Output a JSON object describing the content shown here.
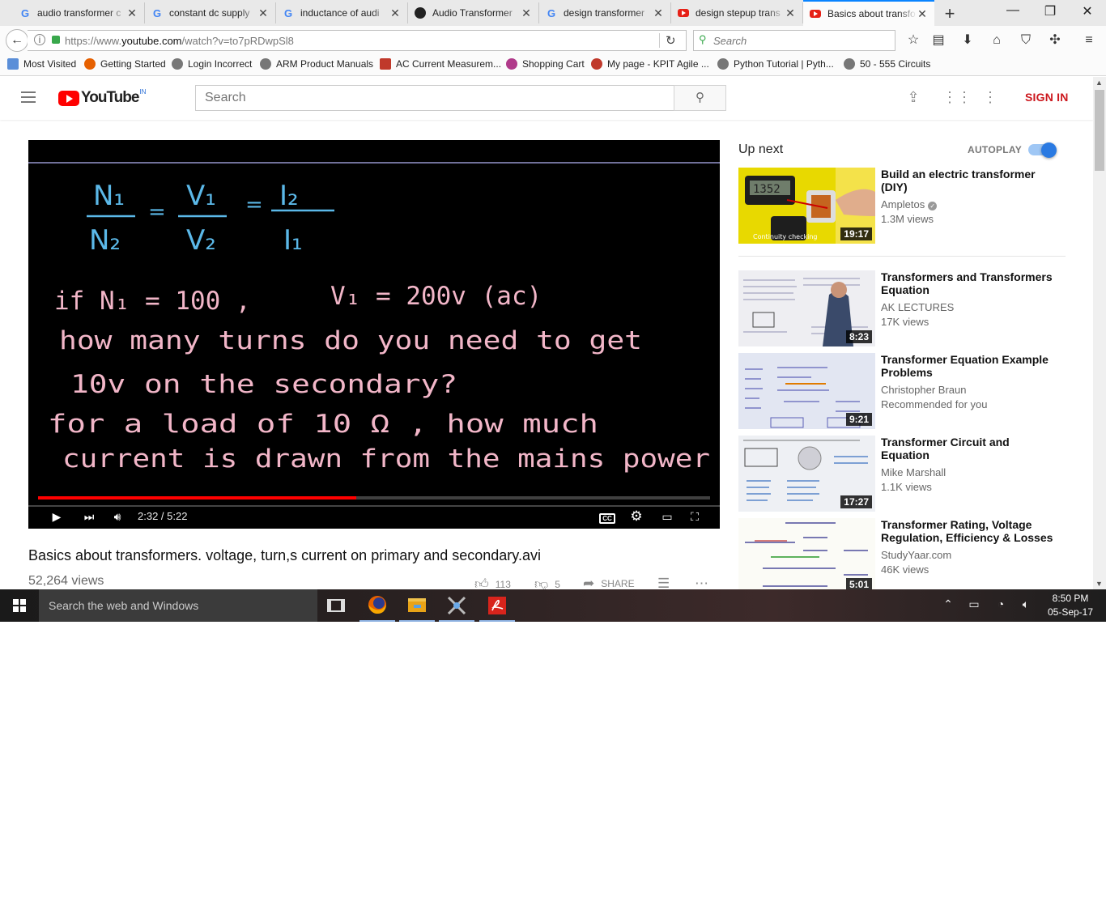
{
  "browser": {
    "tabs": [
      {
        "title": "audio transformer c",
        "icon": "google-icon"
      },
      {
        "title": "constant dc supply",
        "icon": "google-icon"
      },
      {
        "title": "inductance of audi",
        "icon": "google-icon"
      },
      {
        "title": "Audio Transformer",
        "icon": "site-icon"
      },
      {
        "title": "design transformer",
        "icon": "google-icon"
      },
      {
        "title": "design stepup trans",
        "icon": "youtube-icon"
      },
      {
        "title": "Basics about transfo",
        "icon": "youtube-icon"
      }
    ],
    "url_prefix": "https://www.",
    "url_host": "youtube.com",
    "url_path": "/watch?v=to7pRDwpSl8",
    "search_placeholder": "Search",
    "bookmarks": [
      "Most Visited",
      "Getting Started",
      "Login Incorrect",
      "ARM Product Manuals",
      "AC Current Measurem...",
      "Shopping Cart",
      "My page - KPIT Agile ...",
      "Python Tutorial | Pyth...",
      "50 - 555 Circuits"
    ]
  },
  "youtube": {
    "logo_text": "YouTube",
    "country_code": "IN",
    "search_placeholder": "Search",
    "sign_in": "SIGN IN"
  },
  "player": {
    "time_current": "2:32",
    "time_total": "5:22",
    "progress_fraction": 0.473,
    "cc_label": "CC",
    "board_lines": {
      "n1": "N₁",
      "n2": "N₂",
      "v1": "V₁",
      "v2": "V₂",
      "i2": "I₂",
      "i1": "I₁",
      "line1a": "if   N₁ = 100  ,",
      "line1b": "V₁ = 200v (ac)",
      "line2": "how many  turns  do  you  need  to  get",
      "line3": "10v   on   the   secondary?",
      "line4": "for  a  load  of  10 Ω  ,  how  much",
      "line5": "current  is  drawn  from the  mains  power"
    }
  },
  "video": {
    "title": "Basics about transformers. voltage, turn,s current on primary and secondary.avi",
    "views": "52,264 views",
    "likes": "113",
    "dislikes": "5",
    "share": "SHARE"
  },
  "sidebar": {
    "up_next": "Up next",
    "autoplay": "AUTOPLAY",
    "autoplay_on": true,
    "thumb0_caption": "Continuity checking",
    "thumb0_readout": "1352",
    "recommendations": [
      {
        "title": "Build an electric transformer (DIY)",
        "channel": "Ampletos",
        "meta": "1.3M views",
        "duration": "19:17"
      },
      {
        "title": "Transformers and Transformers Equation",
        "channel": "AK LECTURES",
        "meta": "17K views",
        "duration": "8:23"
      },
      {
        "title": "Transformer Equation Example Problems",
        "channel": "Christopher Braun",
        "meta": "Recommended for you",
        "duration": "9:21"
      },
      {
        "title": "Transformer Circuit and Equation",
        "channel": "Mike Marshall",
        "meta": "1.1K views",
        "duration": "17:27"
      },
      {
        "title": "Transformer Rating, Voltage Regulation, Efficiency & Losses",
        "channel": "StudyYaar.com",
        "meta": "46K views",
        "duration": "5:01"
      }
    ]
  },
  "taskbar": {
    "search_placeholder": "Search the web and Windows",
    "time": "8:50 PM",
    "date": "05-Sep-17"
  }
}
